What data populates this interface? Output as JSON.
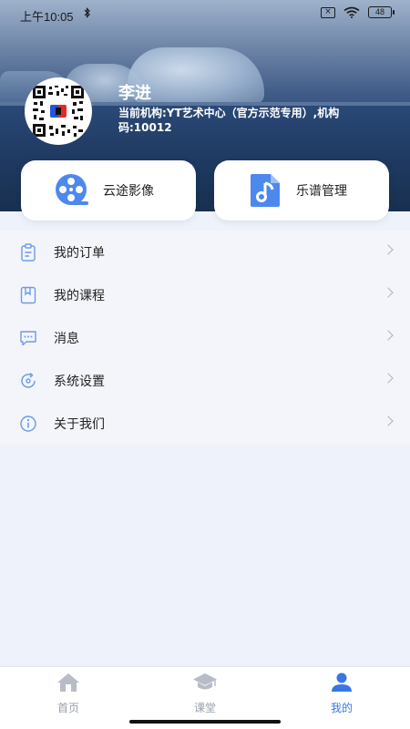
{
  "status_bar": {
    "time": "上午10:05",
    "battery": "48"
  },
  "profile": {
    "name": "李进",
    "org_info": "当前机构:YT艺术中心（官方示范专用）,机构码:10012"
  },
  "feature_cards": [
    {
      "label": "云途影像",
      "icon": "film-reel-icon"
    },
    {
      "label": "乐谱管理",
      "icon": "music-doc-icon"
    }
  ],
  "menu": [
    {
      "label": "我的订单",
      "icon": "clipboard-icon"
    },
    {
      "label": "我的课程",
      "icon": "bookmark-icon"
    },
    {
      "label": "消息",
      "icon": "message-icon"
    },
    {
      "label": "系统设置",
      "icon": "settings-icon"
    },
    {
      "label": "关于我们",
      "icon": "info-icon"
    }
  ],
  "bottom_nav": [
    {
      "label": "首页",
      "icon": "home-icon",
      "active": false
    },
    {
      "label": "课堂",
      "icon": "graduation-cap-icon",
      "active": false
    },
    {
      "label": "我的",
      "icon": "user-icon",
      "active": true
    }
  ],
  "colors": {
    "accent": "#3a75e6",
    "inactive": "#9aa0aa",
    "page_background": "#eef2fb"
  }
}
